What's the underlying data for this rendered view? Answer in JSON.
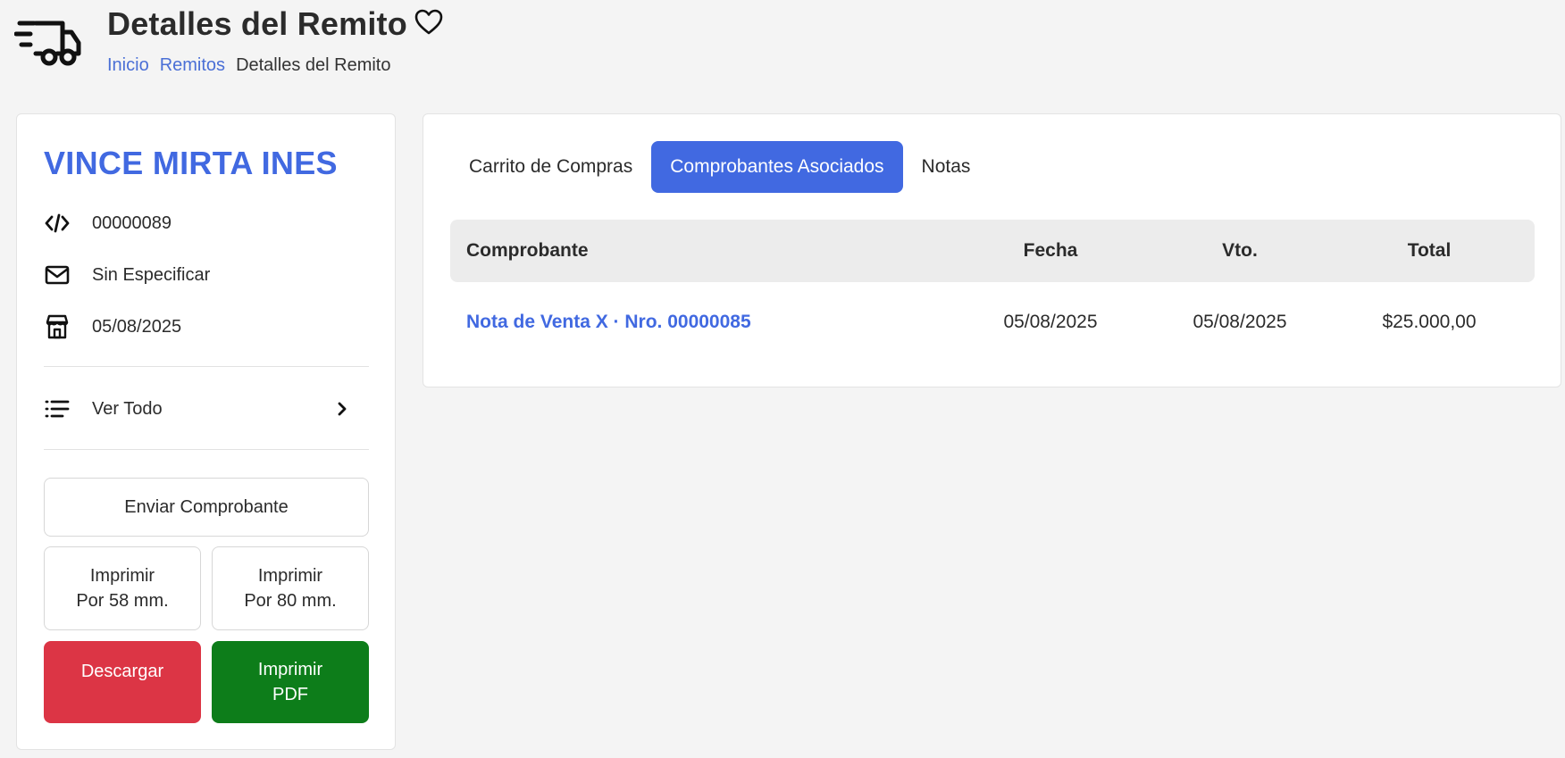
{
  "header": {
    "title": "Detalles del Remito",
    "breadcrumb": [
      {
        "label": "Inicio"
      },
      {
        "label": "Remitos"
      },
      {
        "label": "Detalles del Remito"
      }
    ]
  },
  "client": {
    "name": "VINCE MIRTA INES",
    "code": "00000089",
    "email": "Sin Especificar",
    "date": "05/08/2025",
    "view_all_label": "Ver Todo"
  },
  "actions": {
    "send": "Enviar Comprobante",
    "print58": "Imprimir\nPor 58 mm.",
    "print80": "Imprimir\nPor 80 mm.",
    "download": "Descargar",
    "print_pdf": "Imprimir\nPDF"
  },
  "tabs": [
    {
      "label": "Carrito de Compras",
      "active": false
    },
    {
      "label": "Comprobantes Asociados",
      "active": true
    },
    {
      "label": "Notas",
      "active": false
    }
  ],
  "table": {
    "headers": [
      "Comprobante",
      "Fecha",
      "Vto.",
      "Total"
    ],
    "rows": [
      [
        "Nota de Venta X · Nro. 00000085",
        "05/08/2025",
        "05/08/2025",
        "$25.000,00"
      ]
    ]
  },
  "colors": {
    "accent": "#4169e1",
    "danger": "#dc3545",
    "success": "#0d7d1a"
  },
  "icons": {
    "page": "delivery-truck-icon",
    "favorite": "heart-outline-icon",
    "code": "code-icon",
    "email": "envelope-icon",
    "date": "store-icon",
    "list": "list-icon",
    "chevron": "chevron-right-icon"
  }
}
